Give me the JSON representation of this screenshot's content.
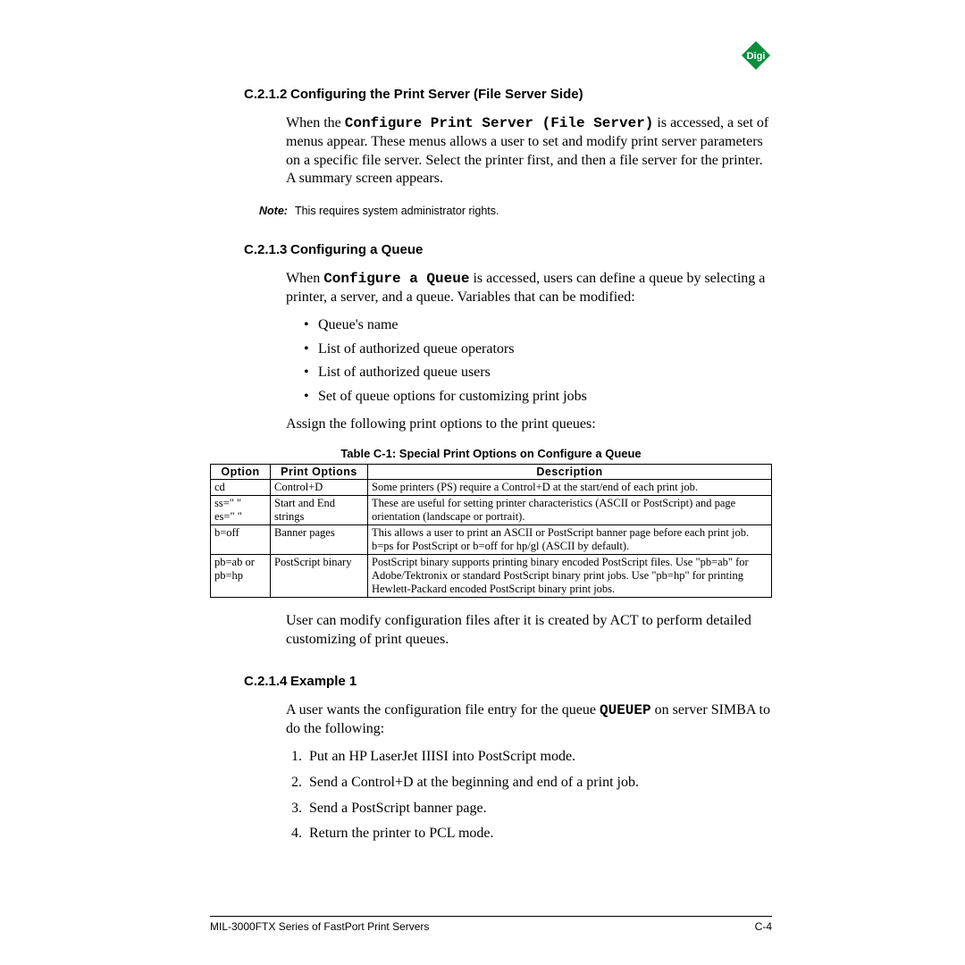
{
  "logo_text": "Digi",
  "sections": {
    "s212": {
      "num": "C.2.1.2",
      "title": "Configuring the Print Server (File Server Side)",
      "para_pre": "When the ",
      "para_mono": "Configure Print Server (File Server)",
      "para_post": " is accessed, a set of menus appear. These menus allows a user to set and modify print server parameters on a specific file server. Select the printer first, and then a file server for the printer. A summary screen appears.",
      "note_label": "Note:",
      "note_text": "This requires system administrator rights."
    },
    "s213": {
      "num": "C.2.1.3",
      "title": "Configuring a Queue",
      "para_pre": "When ",
      "para_mono": "Configure a Queue",
      "para_post": " is accessed, users can define a queue by selecting a printer, a server, and a queue.  Variables that can be modified:",
      "bullets": [
        "Queue's name",
        "List of authorized queue operators",
        "List of authorized queue users",
        "Set of queue options for customizing print jobs"
      ],
      "after_bullets": "Assign the following print options to the print queues:",
      "after_table": "User can modify configuration files after it is created by ACT to perform detailed customizing of print queues."
    },
    "s214": {
      "num": "C.2.1.4",
      "title": "Example 1",
      "para_pre": "A user wants the configuration file entry for the queue ",
      "para_mono": "QUEUEP",
      "para_post": " on server SIMBA to do the following:",
      "steps": [
        "Put an HP LaserJet IIISI into PostScript mode.",
        "Send a Control+D at the beginning and end of a print job.",
        "Send a PostScript banner page.",
        "Return the printer to PCL mode."
      ]
    }
  },
  "table": {
    "caption": "Table C-1: Special Print Options on Configure a Queue",
    "headers": {
      "opt": "Option",
      "po": "Print Options",
      "desc": "Description"
    },
    "rows": [
      {
        "opt": "cd",
        "po": "Control+D",
        "desc": "Some printers (PS) require a Control+D at the start/end of each print job."
      },
      {
        "opt": "ss=\" \"\nes=\" \"",
        "po": "Start and End strings",
        "desc": "These are useful for setting printer characteristics (ASCII or PostScript) and page orientation (landscape or portrait)."
      },
      {
        "opt": "b=off",
        "po": "Banner pages",
        "desc": "This allows a user to print an ASCII or PostScript banner page before each print job. b=ps for PostScript or b=off for hp/gl (ASCII by default)."
      },
      {
        "opt": "pb=ab or pb=hp",
        "po": "PostScript binary",
        "desc": "PostScript binary supports printing binary encoded PostScript files. Use \"pb=ab\" for Adobe/Tektronix or standard PostScript binary print jobs. Use \"pb=hp\" for printing Hewlett-Packard encoded PostScript binary print jobs."
      }
    ]
  },
  "footer": {
    "left": "MIL-3000FTX Series of FastPort Print Servers",
    "right": "C-4"
  }
}
